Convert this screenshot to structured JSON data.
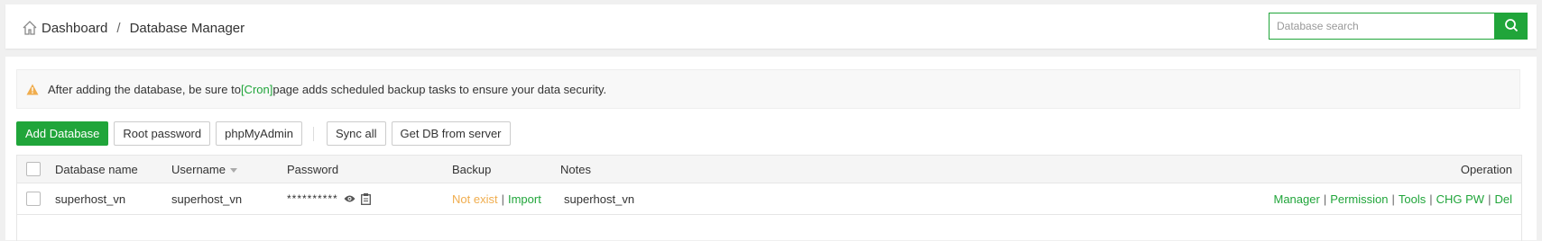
{
  "breadcrumb": {
    "home": "Dashboard",
    "separator": "/",
    "current": "Database Manager"
  },
  "search": {
    "placeholder": "Database search",
    "value": ""
  },
  "notice": {
    "before": "After adding the database, be sure to ",
    "link": "[Cron]",
    "after": " page adds scheduled backup tasks to ensure your data security."
  },
  "toolbar": {
    "add_database": "Add Database",
    "root_password": "Root password",
    "phpmyadmin": "phpMyAdmin",
    "sync_all": "Sync all",
    "get_db_from_server": "Get DB from server"
  },
  "table": {
    "headers": {
      "name": "Database name",
      "username": "Username",
      "password": "Password",
      "backup": "Backup",
      "notes": "Notes",
      "operation": "Operation"
    },
    "rows": [
      {
        "name": "superhost_vn",
        "username": "superhost_vn",
        "password": "**********",
        "backup_status": "Not exist",
        "backup_import": "Import",
        "notes": "superhost_vn",
        "ops": {
          "manager": "Manager",
          "permission": "Permission",
          "tools": "Tools",
          "chg_pw": "CHG PW",
          "del": "Del"
        }
      }
    ]
  },
  "colors": {
    "accent": "#20a53a",
    "warning": "#f0ad4e"
  },
  "icons": {
    "home": "home-icon",
    "search": "search-icon",
    "warning": "warning-icon",
    "eye": "eye-icon",
    "copy": "copy-icon",
    "sort": "sort-down-icon"
  }
}
